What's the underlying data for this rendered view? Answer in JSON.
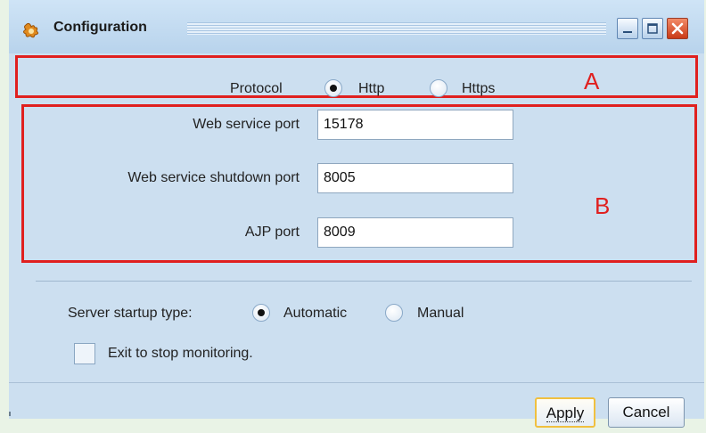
{
  "window": {
    "title": "Configuration"
  },
  "annotations": {
    "a": "A",
    "b": "B"
  },
  "protocol": {
    "label": "Protocol",
    "options": [
      {
        "label": "Http",
        "selected": true
      },
      {
        "label": "Https",
        "selected": false
      }
    ]
  },
  "ports": [
    {
      "label": "Web service port",
      "value": "15178"
    },
    {
      "label": "Web service shutdown port",
      "value": "8005"
    },
    {
      "label": "AJP port",
      "value": "8009"
    }
  ],
  "startup": {
    "label": "Server startup type:",
    "options": [
      {
        "label": "Automatic",
        "selected": true
      },
      {
        "label": "Manual",
        "selected": false
      }
    ]
  },
  "exit_option": {
    "label": "Exit to stop monitoring.",
    "checked": false
  },
  "buttons": {
    "apply": "Apply",
    "cancel": "Cancel"
  },
  "colors": {
    "annotation_red": "#e0201f",
    "window_bg": "#ccdff0",
    "apply_focus": "#f0c040"
  }
}
